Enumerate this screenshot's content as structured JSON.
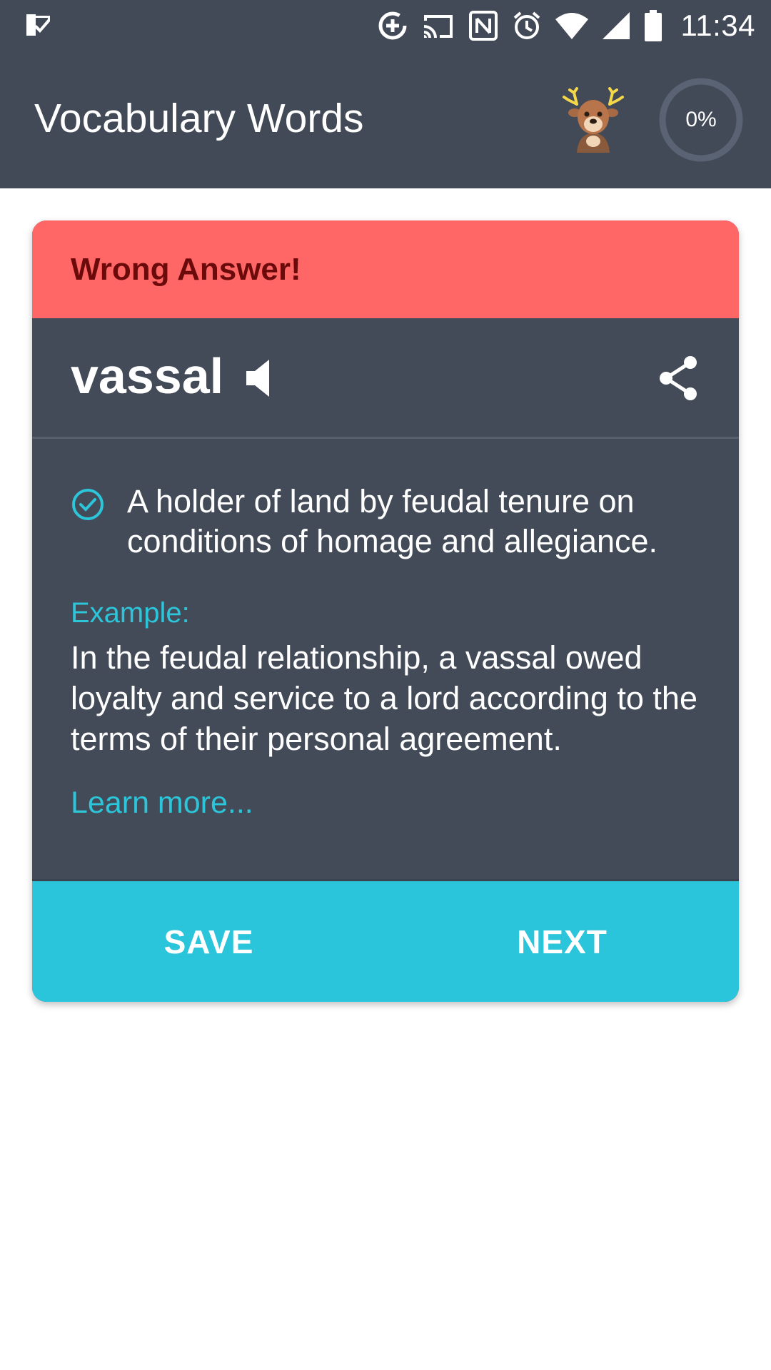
{
  "status_bar": {
    "time": "11:34",
    "icons": [
      "app-check-icon",
      "data-saver-icon",
      "cast-icon",
      "nfc-icon",
      "alarm-icon",
      "wifi-icon",
      "signal-icon",
      "battery-icon"
    ]
  },
  "app_bar": {
    "title": "Vocabulary Words",
    "mascot_icon": "deer-icon",
    "progress_percent": 0,
    "progress_label": "0%"
  },
  "card": {
    "result": "Wrong Answer!",
    "word": "vassal",
    "definition": "A holder of land by feudal tenure on conditions of homage and allegiance.",
    "example_label": "Example:",
    "example_text": "In the feudal relationship, a vassal owed loyalty and service to a lord according to the terms of their personal agreement.",
    "learn_more": "Learn more...",
    "actions": {
      "save": "SAVE",
      "next": "NEXT"
    }
  },
  "colors": {
    "app_bar": "#424a57",
    "card_body": "#434b58",
    "wrong_banner": "#ff6666",
    "wrong_text": "#6b0a0a",
    "accent": "#2bc5db"
  }
}
